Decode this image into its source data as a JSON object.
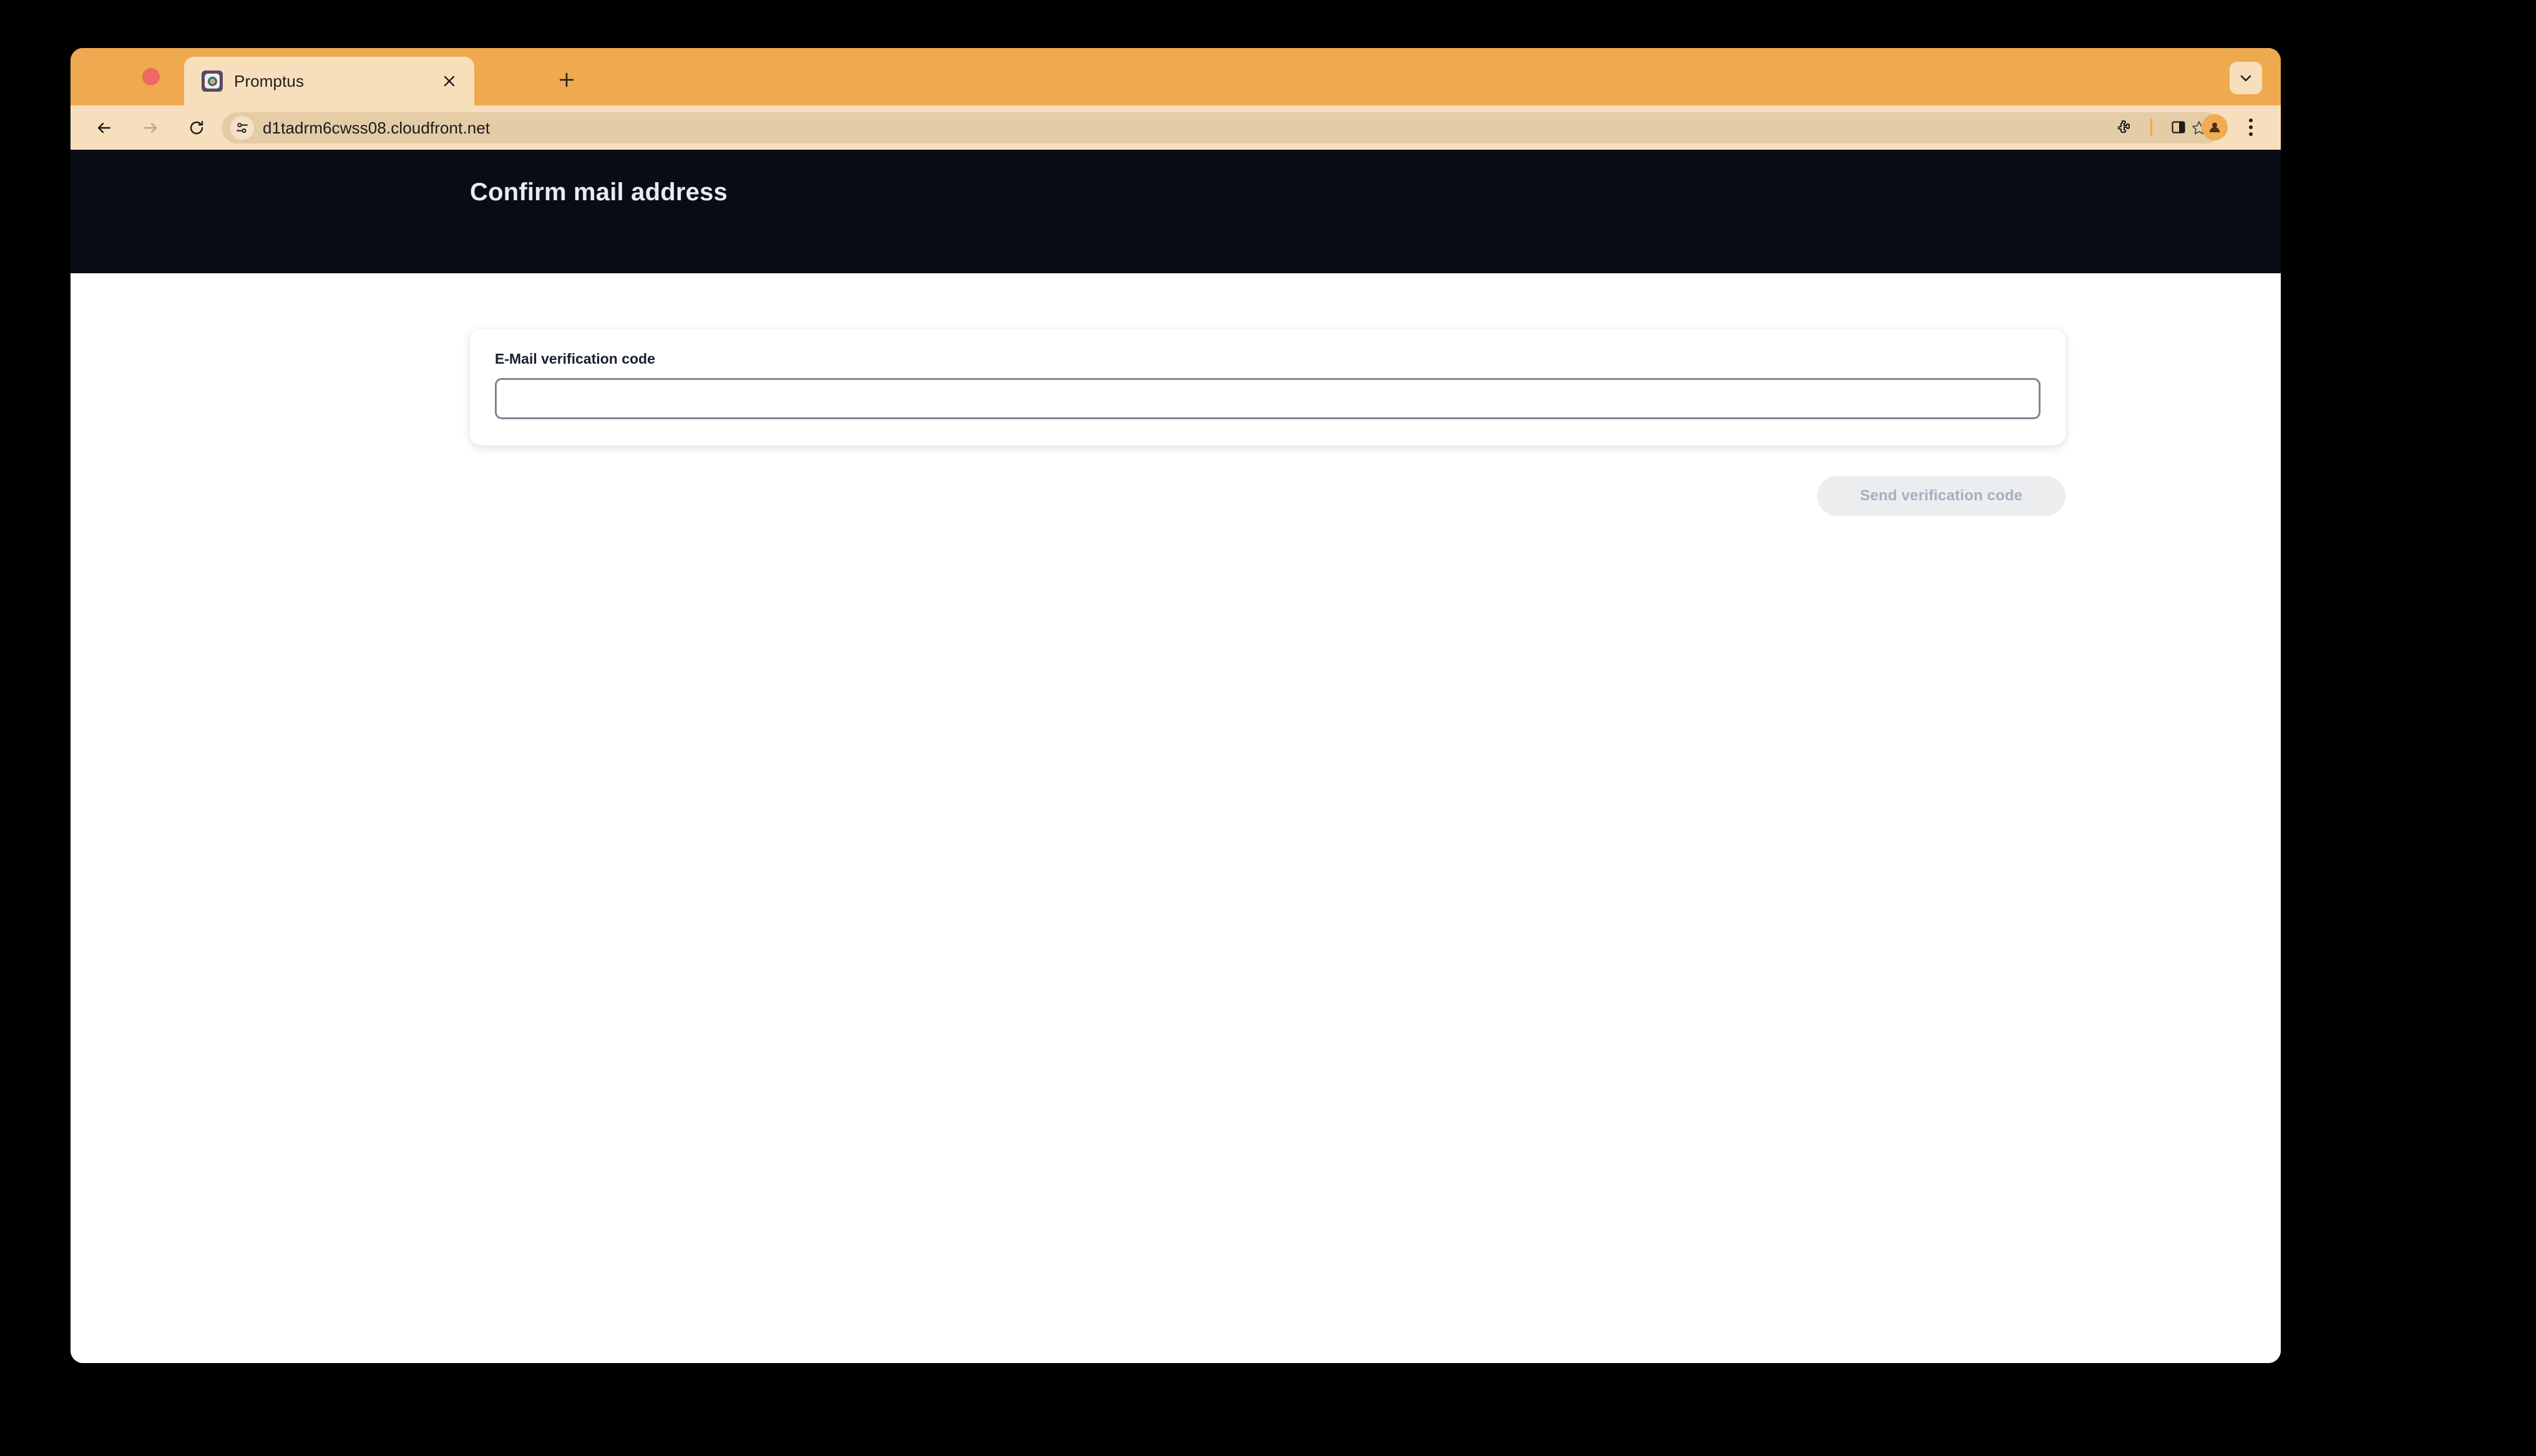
{
  "browser": {
    "traffic_lights": [
      "close",
      "minimize",
      "maximize"
    ],
    "tab": {
      "title": "Promptus",
      "favicon": "promptus-favicon",
      "close_label": "✕"
    },
    "new_tab_label": "+",
    "tab_list_chevron": "chevron-down-icon",
    "nav": {
      "back": "back-arrow-icon",
      "forward": "forward-arrow-icon",
      "reload": "reload-icon"
    },
    "omnibox": {
      "url": "d1tadrm6cwss08.cloudfront.net",
      "site_settings_icon": "tune-icon",
      "bookmark_icon": "star-icon"
    },
    "toolbar_right": {
      "extensions": "puzzle-icon",
      "side_panel": "side-panel-icon",
      "profile": "avatar-icon",
      "menu": "three-dot-menu-icon"
    },
    "colors": {
      "tabstrip": "#efa94f",
      "toolbar": "#f7dfbd",
      "active_tab": "#f8dfbc",
      "omnibox": "#e4cca7"
    }
  },
  "page": {
    "header": {
      "title": "Confirm mail address",
      "background": "#070c17",
      "text_color": "#e9ebee"
    },
    "form": {
      "label": "E-Mail verification code",
      "input_value": "",
      "input_placeholder": "",
      "submit_label": "Send verification code",
      "submit_disabled": true,
      "submit_bg": "#ecedef",
      "submit_text_color": "#a7afbd"
    }
  }
}
